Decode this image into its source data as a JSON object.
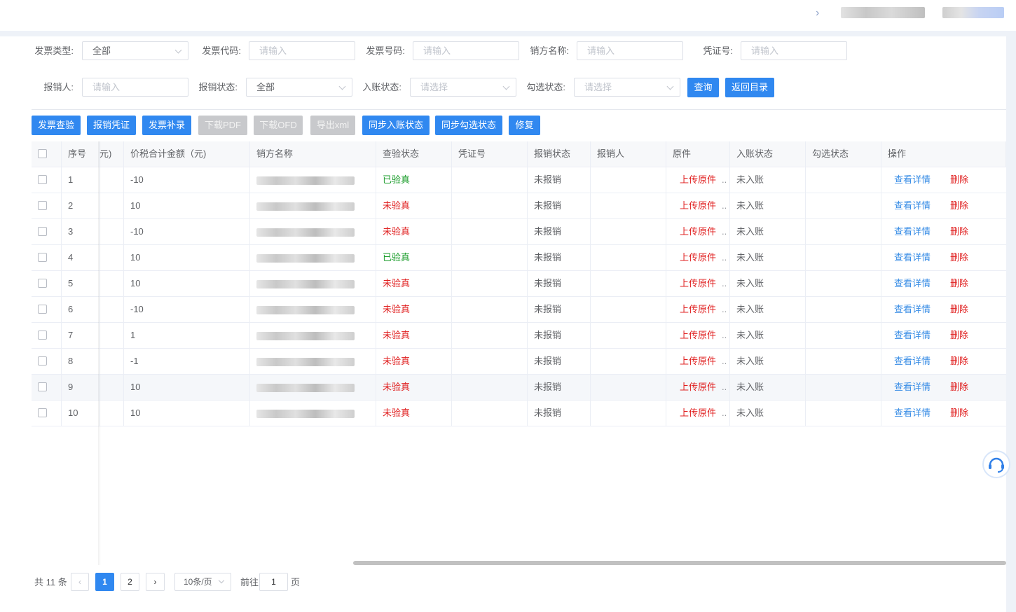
{
  "filters": {
    "row1": [
      {
        "label": "发票类型:",
        "value": "全部",
        "type": "select"
      },
      {
        "label": "发票代码:",
        "placeholder": "请输入",
        "type": "input"
      },
      {
        "label": "发票号码:",
        "placeholder": "请输入",
        "type": "input"
      },
      {
        "label": "销方名称:",
        "placeholder": "请输入",
        "type": "input"
      },
      {
        "label": "凭证号:",
        "placeholder": "请输入",
        "type": "input"
      }
    ],
    "row2": [
      {
        "label": "报销人:",
        "placeholder": "请输入",
        "type": "input"
      },
      {
        "label": "报销状态:",
        "value": "全部",
        "type": "select"
      },
      {
        "label": "入账状态:",
        "placeholder": "请选择",
        "type": "select"
      },
      {
        "label": "勾选状态:",
        "placeholder": "请选择",
        "type": "select"
      }
    ],
    "query_label": "查询",
    "back_label": "返回目录"
  },
  "toolbar": [
    {
      "label": "发票查验",
      "disabled": false
    },
    {
      "label": "报销凭证",
      "disabled": false
    },
    {
      "label": "发票补录",
      "disabled": false
    },
    {
      "label": "下载PDF",
      "disabled": true
    },
    {
      "label": "下载OFD",
      "disabled": true
    },
    {
      "label": "导出xml",
      "disabled": true
    },
    {
      "label": "同步入账状态",
      "disabled": false
    },
    {
      "label": "同步勾选状态",
      "disabled": false
    },
    {
      "label": "修复",
      "disabled": false
    }
  ],
  "table": {
    "headers": [
      "序号",
      "元)",
      "价税合计金额（元)",
      "销方名称",
      "查验状态",
      "凭证号",
      "报销状态",
      "报销人",
      "原件",
      "入账状态",
      "勾选状态",
      "操作"
    ],
    "rows": [
      {
        "no": "1",
        "amount": "-10",
        "check": "已验真",
        "status": "未报销",
        "file": "上传原件",
        "acct": "未入账"
      },
      {
        "no": "2",
        "amount": "10",
        "check": "未验真",
        "status": "未报销",
        "file": "上传原件",
        "acct": "未入账"
      },
      {
        "no": "3",
        "amount": "-10",
        "check": "未验真",
        "status": "未报销",
        "file": "上传原件",
        "acct": "未入账"
      },
      {
        "no": "4",
        "amount": "10",
        "check": "已验真",
        "status": "未报销",
        "file": "上传原件",
        "acct": "未入账"
      },
      {
        "no": "5",
        "amount": "10",
        "check": "未验真",
        "status": "未报销",
        "file": "上传原件",
        "acct": "未入账"
      },
      {
        "no": "6",
        "amount": "-10",
        "check": "未验真",
        "status": "未报销",
        "file": "上传原件",
        "acct": "未入账"
      },
      {
        "no": "7",
        "amount": "1",
        "check": "未验真",
        "status": "未报销",
        "file": "上传原件",
        "acct": "未入账"
      },
      {
        "no": "8",
        "amount": "-1",
        "check": "未验真",
        "status": "未报销",
        "file": "上传原件",
        "acct": "未入账"
      },
      {
        "no": "9",
        "amount": "10",
        "check": "未验真",
        "status": "未报销",
        "file": "上传原件",
        "acct": "未入账"
      },
      {
        "no": "10",
        "amount": "10",
        "check": "未验真",
        "status": "未报销",
        "file": "上传原件",
        "acct": "未入账"
      }
    ],
    "detail_label": "查看详情",
    "delete_label": "删除",
    "ellipsis": ".."
  },
  "pagination": {
    "total": "共 11 条",
    "pages": [
      "1",
      "2"
    ],
    "page_size": "10条/页",
    "goto_label": "前往",
    "goto_value": "1",
    "page_suffix": "页"
  },
  "colors": {
    "primary": "#3088f0",
    "verified": "#1a9c2a",
    "unverified": "#e02020",
    "link": "#3a8ee6"
  }
}
